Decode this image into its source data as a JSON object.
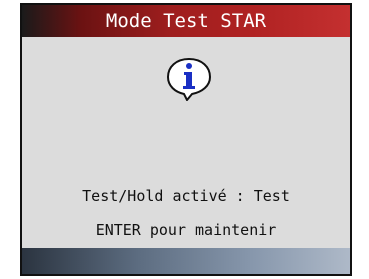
{
  "header": {
    "title": "Mode Test STAR"
  },
  "content": {
    "icon": "info-speech-bubble-icon",
    "line1": "Test/Hold activé : Test",
    "line2": "ENTER pour maintenir"
  },
  "colors": {
    "title_bar_accent": "#b02222",
    "screen_background": "#dcdcdc",
    "icon_blue": "#1a2fc4",
    "bottom_bar": "#5c6c80"
  }
}
